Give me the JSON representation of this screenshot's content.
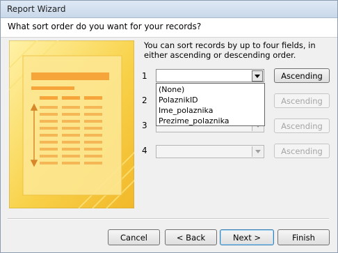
{
  "window": {
    "title": "Report Wizard"
  },
  "header": {
    "question": "What sort order do you want for your records?"
  },
  "description": "You can sort records by up to four fields, in either ascending or descending order.",
  "sort_rows": [
    {
      "number": "1",
      "value": "",
      "order_label": "Ascending",
      "enabled": true
    },
    {
      "number": "2",
      "value": "",
      "order_label": "Ascending",
      "enabled": false
    },
    {
      "number": "3",
      "value": "",
      "order_label": "Ascending",
      "enabled": false
    },
    {
      "number": "4",
      "value": "",
      "order_label": "Ascending",
      "enabled": false
    }
  ],
  "dropdown_options": [
    "(None)",
    "PolaznikID",
    "Ime_polaznika",
    "Prezime_polaznika"
  ],
  "footer": {
    "cancel": "Cancel",
    "back": "< Back",
    "next": "Next >",
    "finish": "Finish"
  },
  "colors": {
    "illustration_yellow": "#f7c93c",
    "illustration_orange": "#f5a53a",
    "default_button_border": "#3c7fb1"
  }
}
